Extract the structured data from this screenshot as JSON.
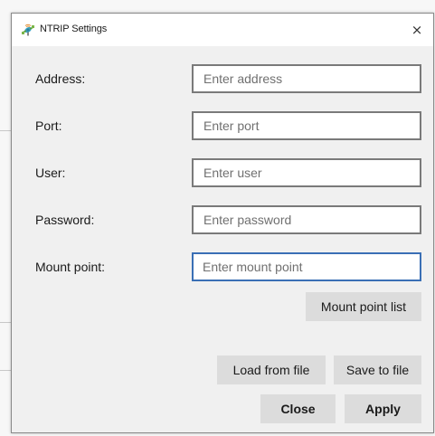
{
  "window": {
    "title": "NTRIP Settings",
    "close_glyph": "×"
  },
  "form": {
    "address": {
      "label": "Address:",
      "placeholder": "Enter address",
      "value": ""
    },
    "port": {
      "label": "Port:",
      "placeholder": "Enter port",
      "value": ""
    },
    "user": {
      "label": "User:",
      "placeholder": "Enter user",
      "value": ""
    },
    "password": {
      "label": "Password:",
      "placeholder": "Enter password",
      "value": ""
    },
    "mount_point": {
      "label": "Mount point:",
      "placeholder": "Enter mount point",
      "value": ""
    }
  },
  "buttons": {
    "mount_point_list": "Mount point list",
    "load_from_file": "Load from file",
    "save_to_file": "Save to file",
    "close": "Close",
    "apply": "Apply"
  },
  "icons": {
    "app": "satellite-dish-icon",
    "close": "close-icon"
  },
  "colors": {
    "focus_border": "#3a6fb5",
    "button_face": "#dcdcdc",
    "dialog_bg": "#f0f0f0"
  }
}
